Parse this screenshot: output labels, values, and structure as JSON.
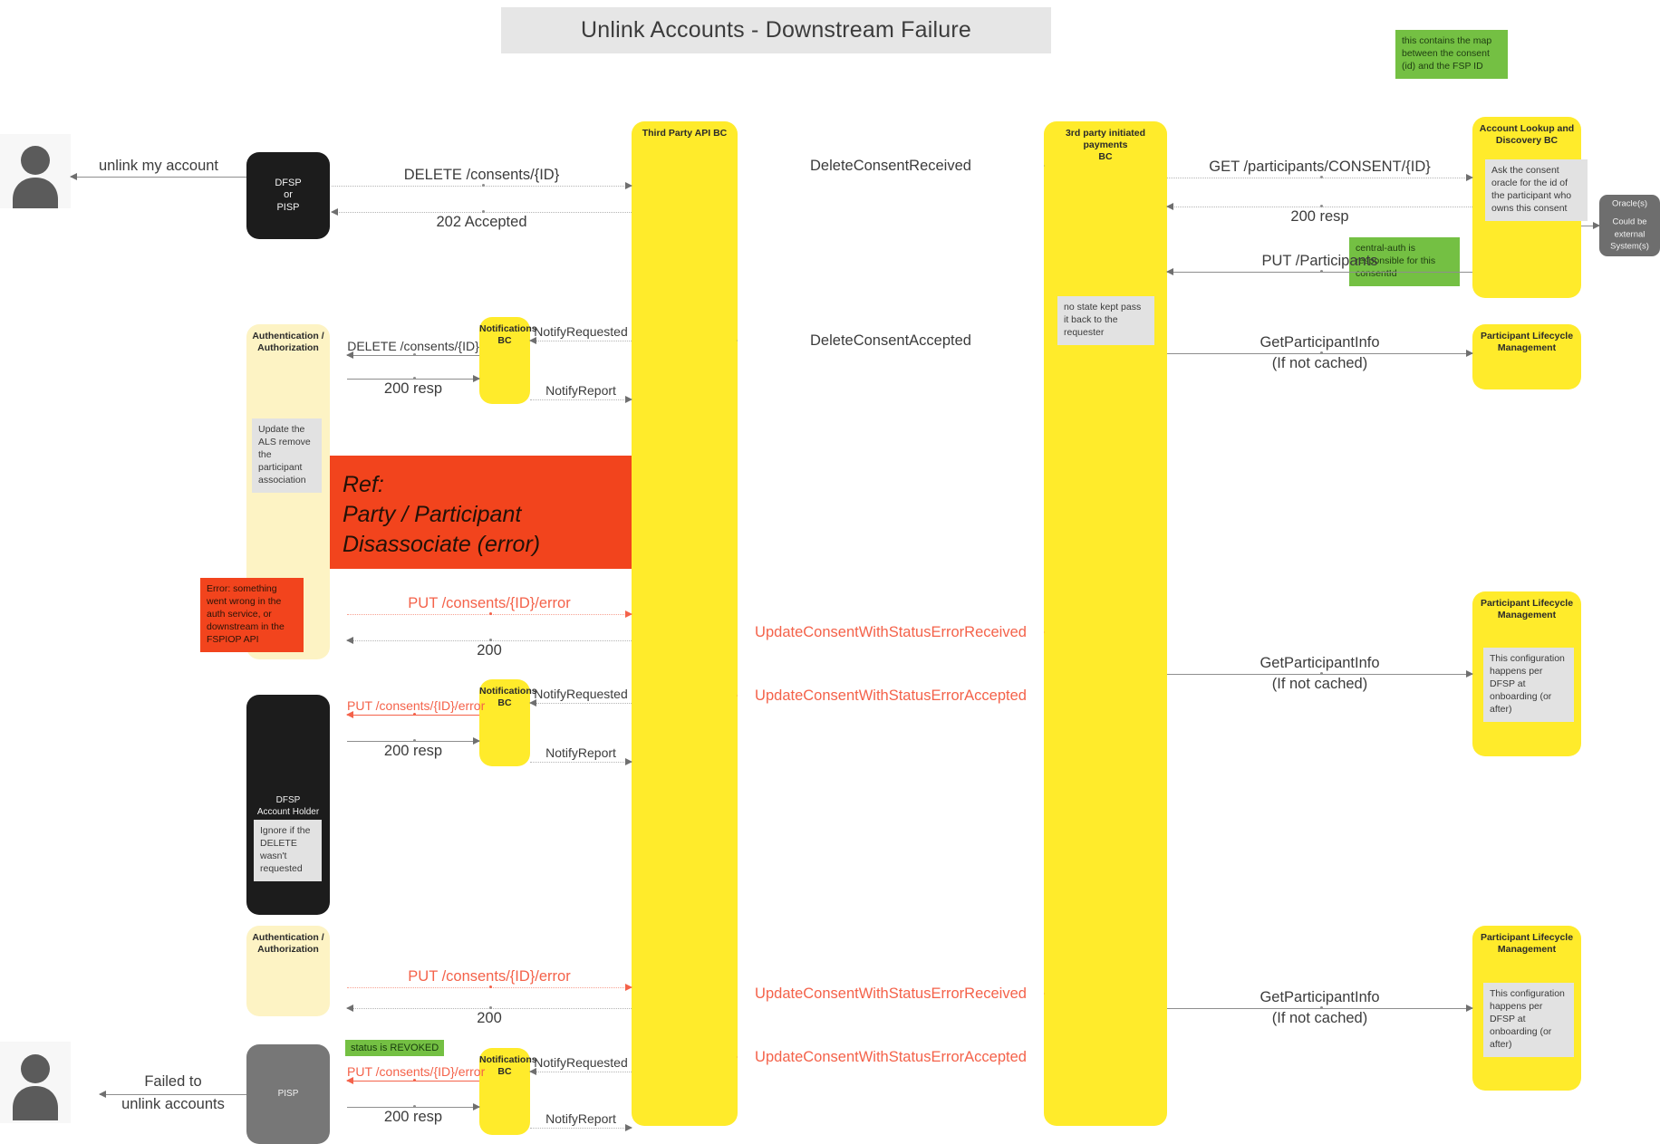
{
  "title": "Unlink Accounts - Downstream Failure",
  "colors": {
    "lane_yellow": "#ffeb2b",
    "lane_cream": "#fdf3c4",
    "lane_black": "#1c1c1c",
    "lane_grey": "#777777",
    "ref_red": "#f2441d",
    "note_green": "#74c043",
    "note_grey": "#e2e2e2",
    "error_text": "#f4624a",
    "title_bg": "#e6e6e6"
  },
  "lanes": {
    "dfsp_or_pisp": "DFSP\nor\nPISP",
    "dfsp_or_pisp_lines": [
      "DFSP",
      "or",
      "PISP"
    ],
    "auth_top": "Authentication /\nAuthorization",
    "auth_bottom": "Authentication /\nAuthorization",
    "notifications_bc": "Notifications\nBC",
    "third_party_api_bc": "Third Party API BC",
    "tp_initiated_payments_bc": "3rd party initiated payments\nBC",
    "account_lookup_discovery_bc": "Account Lookup and\nDiscovery BC",
    "participant_lifecycle_mgmt": "Participant Lifecycle\nManagement",
    "oracles": "Oracle(s)\n\nCould be\nexternal\nSystem(s)",
    "oracles_lines": [
      "Oracle(s)",
      "Could be",
      "external",
      "System(s)"
    ],
    "dfsp_account_holder_lines": [
      "DFSP",
      "Account Holder"
    ],
    "pisp": "PISP"
  },
  "notes": {
    "consent_map": "this contains the map between the consent (id) and the FSP ID",
    "ask_oracle": "Ask the consent oracle for the id of the participant who owns this consent",
    "central_auth": "central-auth is responsible for this consentId",
    "no_state_kept": "no state kept pass it back to the requester",
    "update_als": "Update the ALS remove the participant association",
    "error_note": "Error: something went wrong in the auth service, or downstream in the FSPIOP API",
    "ignore_delete": "Ignore if the DELETE wasn't requested",
    "config_onboarding_1": "This configuration happens per DFSP at onboarding (or after)",
    "config_onboarding_2": "This configuration happens per DFSP at onboarding (or after)",
    "status_revoked": "status is REVOKED"
  },
  "ref_frame": {
    "line1": "Ref:",
    "line2": "Party / Participant",
    "line3": "Disassociate (error)"
  },
  "messages": {
    "unlink_my_account": "unlink my account",
    "delete_consents_id": "DELETE /consents/{ID}",
    "accepted_202": "202 Accepted",
    "delete_consent_received": "DeleteConsentReceived",
    "get_participants_consent_id": "GET /participants/CONSENT/{ID}",
    "resp_200": "200 resp",
    "put_participants": "PUT /Participants",
    "delete_consents_id_2": "DELETE /consents/{ID}",
    "notify_requested_1": "NotifyRequested",
    "notify_report_1": "NotifyReport",
    "resp_200_b": "200 resp",
    "delete_consent_accepted": "DeleteConsentAccepted",
    "get_participant_info": "GetParticipantInfo",
    "if_not_cached": "(If not cached)",
    "put_consents_id_error_1": "PUT /consents/{ID}/error",
    "code_200_1": "200",
    "update_consent_error_received_1": "UpdateConsentWithStatusErrorReceived",
    "update_consent_error_accepted_1": "UpdateConsentWithStatusErrorAccepted",
    "get_participant_info_2": "GetParticipantInfo",
    "if_not_cached_2": "(If not cached)",
    "put_consents_id_error_2": "PUT /consents/{ID}/error",
    "notify_requested_2": "NotifyRequested",
    "notify_report_2": "NotifyReport",
    "resp_200_c": "200 resp",
    "put_consents_id_error_3": "PUT /consents/{ID}/error",
    "code_200_2": "200",
    "update_consent_error_received_2": "UpdateConsentWithStatusErrorReceived",
    "update_consent_error_accepted_2": "UpdateConsentWithStatusErrorAccepted",
    "get_participant_info_3": "GetParticipantInfo",
    "if_not_cached_3": "(If not cached)",
    "put_consents_id_error_4": "PUT /consents/{ID}/error",
    "notify_requested_3": "NotifyRequested",
    "notify_report_3": "NotifyReport",
    "resp_200_d": "200 resp",
    "failed_to_unlink_1": "Failed to",
    "failed_to_unlink_2": "unlink accounts"
  }
}
